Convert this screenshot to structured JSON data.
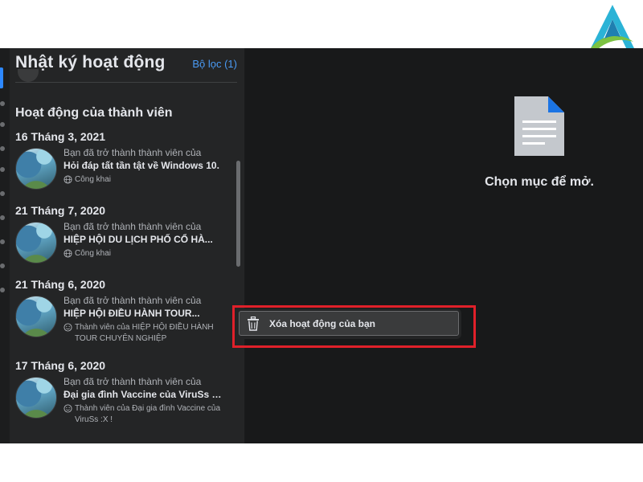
{
  "panel": {
    "title": "Nhật ký hoạt động",
    "filter_label": "Bộ lọc (1)",
    "section_title": "Hoạt động của thành viên"
  },
  "activities": [
    {
      "date": "16 Tháng 3, 2021",
      "line1": "Bạn đã trở thành thành viên của",
      "line2": "Hỏi đáp tất tần tật về Windows 10.",
      "meta_icon": "globe-icon",
      "meta": "Công khai"
    },
    {
      "date": "21 Tháng 7, 2020",
      "line1": "Bạn đã trở thành thành viên của",
      "line2": "HIỆP HỘI DU LỊCH PHỐ CỔ HÀ...",
      "meta_icon": "globe-icon",
      "meta": "Công khai"
    },
    {
      "date": "21 Tháng 6, 2020",
      "line1": "Bạn đã trở thành thành viên của",
      "line2": "HIỆP HỘI ĐIỀU HÀNH TOUR...",
      "meta_icon": "smiley-icon",
      "meta": "Thành viên của HIỆP HỘI ĐIỀU HÀNH TOUR CHUYÊN NGHIỆP"
    },
    {
      "date": "17 Tháng 6, 2020",
      "line1": "Bạn đã trở thành thành viên của",
      "line2": "Đại gia đình Vaccine của ViruSs :X !",
      "meta_icon": "smiley-icon",
      "meta": "Thành viên của Đại gia đình Vaccine của ViruSs :X !"
    }
  ],
  "empty_state": {
    "icon": "document-icon",
    "text": "Chọn mục để mở."
  },
  "context_menu": {
    "icon": "trash-icon",
    "delete_label": "Xóa hoạt động của bạn"
  },
  "colors": {
    "background": "#18191a",
    "panel": "#242526",
    "accent": "#2d88ff",
    "highlight": "#e0202a"
  }
}
